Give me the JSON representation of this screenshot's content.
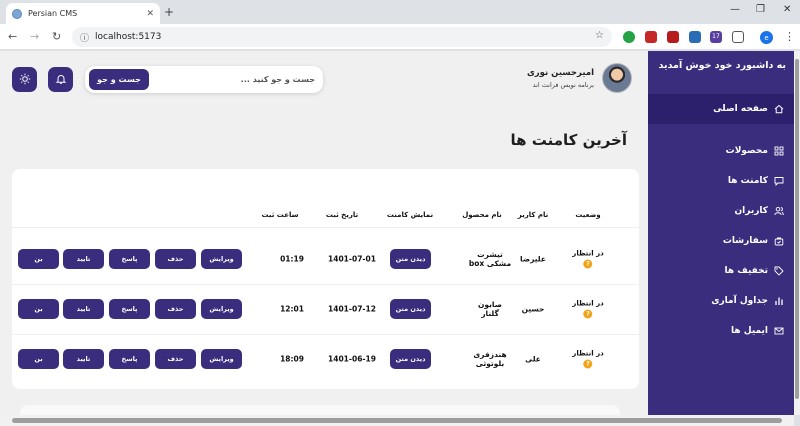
{
  "browser": {
    "tab_title": "Persian CMS",
    "url": "localhost:5173",
    "extension_badge": "17",
    "profile_initial": "e"
  },
  "sidebar": {
    "title": "به داشبورد خود خوش آمدید",
    "items": [
      {
        "label": "صفحه اصلی",
        "icon": "home-icon",
        "active": true
      },
      {
        "label": "محصولات",
        "icon": "grid-icon",
        "active": false
      },
      {
        "label": "کامنت ها",
        "icon": "chat-icon",
        "active": false
      },
      {
        "label": "کاربران",
        "icon": "users-icon",
        "active": false
      },
      {
        "label": "سفارشات",
        "icon": "bag-icon",
        "active": false
      },
      {
        "label": "تخفیف ها",
        "icon": "tag-icon",
        "active": false
      },
      {
        "label": "جداول آماری",
        "icon": "bar-chart-icon",
        "active": false
      },
      {
        "label": "ایمیل ها",
        "icon": "mail-icon",
        "active": false
      }
    ]
  },
  "header": {
    "user_name": "امیرحسین نوری",
    "user_role": "برنامه نویس فرانت اند",
    "search_placeholder": "جست و جو کنید ...",
    "search_button": "جست و جو"
  },
  "page_title": "آخرین کامنت ها",
  "table": {
    "columns": [
      "وضعیت",
      "نام کاربر",
      "نام محصول",
      "نمایش کامنت",
      "تاریخ ثبت",
      "ساعت ثبت"
    ],
    "view_label": "دیدن متن",
    "actions": [
      "ویرایش",
      "حذف",
      "پاسخ",
      "تایید",
      "بن"
    ],
    "rows": [
      {
        "status": "در انتظار",
        "user": "علیرضا",
        "product": "تیشرت مشکی box",
        "date": "1401-07-01",
        "time": "01:19"
      },
      {
        "status": "در انتظار",
        "user": "حسین",
        "product": "صابون گلنار",
        "date": "1401-07-12",
        "time": "12:01"
      },
      {
        "status": "در انتظار",
        "user": "علی",
        "product": "هندزفری بلوتوثی",
        "date": "1401-06-19",
        "time": "18:09"
      }
    ]
  },
  "colors": {
    "primary": "#3b2d7e",
    "status": "#f1a417"
  }
}
